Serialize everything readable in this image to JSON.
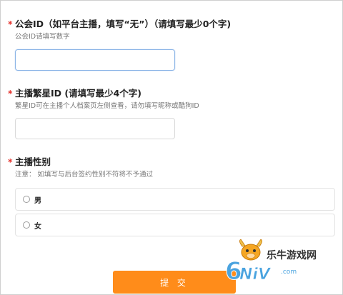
{
  "guild_id": {
    "required_mark": "*",
    "title": "公会ID（如平台主播，填写“无”）（请填写最少0个字)",
    "hint": "公会ID请填写数字",
    "value": ""
  },
  "anchor_id": {
    "required_mark": "*",
    "title": "主播繁星ID (请填写最少4个字)",
    "hint": "繁星ID可在主播个人档案页左侧查看，请勿填写昵称或酷狗ID",
    "value": ""
  },
  "gender": {
    "required_mark": "*",
    "title": "主播性别",
    "hint": "注意： 如填写与后台签约性别不符将不予通过",
    "options": [
      "男",
      "女"
    ]
  },
  "submit": {
    "label": "提 交"
  },
  "watermark": {
    "text": "乐牛游戏网",
    "logo_text": "6NiV.com"
  },
  "colors": {
    "accent": "#ff8c1a",
    "required": "#e5322d"
  }
}
